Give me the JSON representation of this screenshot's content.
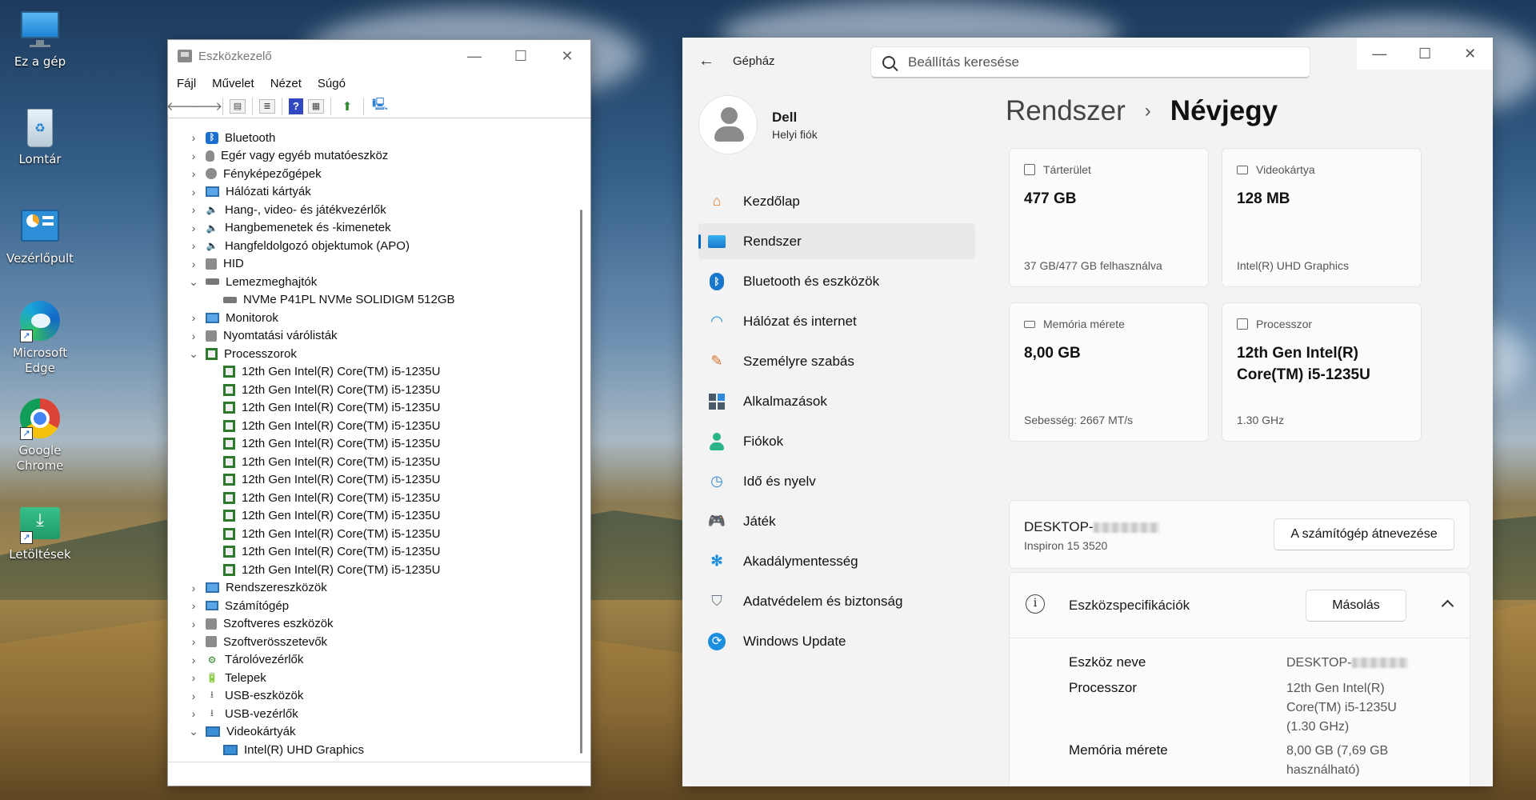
{
  "desktop": {
    "icons": [
      {
        "label": "Ez a gép"
      },
      {
        "label": "Lomtár"
      },
      {
        "label": "Vezérlőpult"
      },
      {
        "label": "Microsoft Edge"
      },
      {
        "label": "Google Chrome"
      },
      {
        "label": "Letöltések"
      }
    ]
  },
  "devmgr": {
    "title": "Eszközkezelő",
    "menu": [
      "Fájl",
      "Művelet",
      "Nézet",
      "Súgó"
    ],
    "tree": {
      "bluetooth": "Bluetooth",
      "mouse": "Egér vagy egyéb mutatóeszköz",
      "cameras": "Fényképezőgépek",
      "network": "Hálózati kártyák",
      "sound": "Hang-, video- és játékvezérlők",
      "audio_io": "Hangbemenetek és -kimenetek",
      "apo": "Hangfeldolgozó objektumok (APO)",
      "hid": "HID",
      "disks": "Lemezmeghajtók",
      "disk0": "NVMe P41PL NVMe SOLIDIGM 512GB",
      "monitors": "Monitorok",
      "print_queues": "Nyomtatási várólisták",
      "processors": "Processzorok",
      "cpu_name": "12th Gen Intel(R) Core(TM) i5-1235U",
      "system_devices": "Rendszereszközök",
      "computer": "Számítógép",
      "software_devices": "Szoftveres eszközök",
      "software_components": "Szoftverösszetevők",
      "storage": "Tárolóvezérlők",
      "batteries": "Telepek",
      "usb_devices": "USB-eszközök",
      "usb_controllers": "USB-vezérlők",
      "display_adapters": "Videokártyák",
      "gpu0": "Intel(R) UHD Graphics"
    }
  },
  "settings": {
    "app_title": "Gépház",
    "search_placeholder": "Beállítás keresése",
    "user": {
      "name": "Dell",
      "account": "Helyi fiók"
    },
    "nav": [
      {
        "label": "Kezdőlap"
      },
      {
        "label": "Rendszer"
      },
      {
        "label": "Bluetooth és eszközök"
      },
      {
        "label": "Hálózat és internet"
      },
      {
        "label": "Személyre szabás"
      },
      {
        "label": "Alkalmazások"
      },
      {
        "label": "Fiókok"
      },
      {
        "label": "Idő és nyelv"
      },
      {
        "label": "Játék"
      },
      {
        "label": "Akadálymentesség"
      },
      {
        "label": "Adatvédelem és biztonság"
      },
      {
        "label": "Windows Update"
      }
    ],
    "breadcrumb": {
      "parent": "Rendszer",
      "current": "Névjegy"
    },
    "cards": {
      "storage": {
        "label": "Tárterület",
        "value": "477 GB",
        "sub": "37 GB/477 GB felhasználva"
      },
      "gpu": {
        "label": "Videokártya",
        "value": "128 MB",
        "sub": "Intel(R) UHD Graphics"
      },
      "memory": {
        "label": "Memória mérete",
        "value": "8,00 GB",
        "sub": "Sebesség: 2667 MT/s"
      },
      "cpu": {
        "label": "Processzor",
        "value_l1": "12th Gen Intel(R)",
        "value_l2": "Core(TM) i5-1235U",
        "sub": "1.30 GHz"
      }
    },
    "device": {
      "name_prefix": "DESKTOP-",
      "model": "Inspiron 15 3520",
      "rename_label": "A számítógép átnevezése"
    },
    "specs": {
      "title": "Eszközspecifikációk",
      "copy_label": "Másolás",
      "device_name_label": "Eszköz neve",
      "device_name_value": "DESKTOP-",
      "processor_label": "Processzor",
      "processor_l1": "12th Gen Intel(R)",
      "processor_l2": "Core(TM) i5-1235U",
      "processor_l3": "(1.30 GHz)",
      "memory_label": "Memória mérete",
      "memory_l1": "8,00 GB (7,69 GB",
      "memory_l2": "használható)"
    }
  },
  "colors": {
    "accent": "#0067c0"
  }
}
